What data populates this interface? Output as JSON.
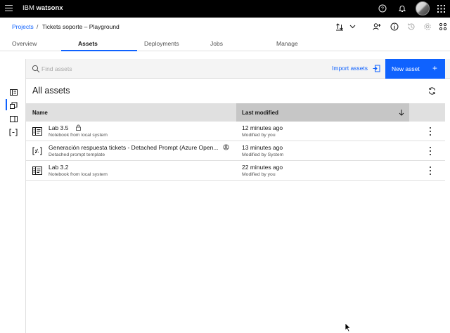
{
  "header": {
    "brand_prefix": "IBM",
    "brand_product": "watsonx",
    "icons": [
      "menu-icon",
      "help-icon",
      "notification-icon",
      "avatar",
      "app-switcher-icon"
    ]
  },
  "breadcrumb": {
    "root": "Projects",
    "separator": "/",
    "current": "Tickets soporte – Playground"
  },
  "tabs": [
    {
      "label": "Overview"
    },
    {
      "label": "Assets",
      "active": true
    },
    {
      "label": "Deployments"
    },
    {
      "label": "Jobs"
    },
    {
      "label": "Manage"
    }
  ],
  "toolbar": {
    "search_placeholder": "Find assets",
    "import_label": "Import assets",
    "new_label": "New asset",
    "new_plus": "+"
  },
  "section": {
    "title": "All assets"
  },
  "table": {
    "columns": {
      "name": "Name",
      "modified": "Last modified"
    },
    "rows": [
      {
        "title": "Lab 3.5",
        "subtitle": "Notebook from local system",
        "modified": "12 minutes ago",
        "by": "Modified by you",
        "icon": "notebook-icon",
        "badge": "lock-icon"
      },
      {
        "title": "Generación respuesta tickets - Detached Prompt (Azure Open...",
        "subtitle": "Detached prompt template",
        "modified": "13 minutes ago",
        "by": "Modified by System",
        "icon": "prompt-template-icon",
        "badge": "badge-icon"
      },
      {
        "title": "Lab 3.2",
        "subtitle": "Notebook from local system",
        "modified": "22 minutes ago",
        "by": "Modified by you",
        "icon": "notebook-icon"
      }
    ]
  },
  "colors": {
    "accent": "#0f62fe",
    "header_bg": "#000000",
    "table_header": "#e0e0e0",
    "sorted_header": "#c6c6c6"
  }
}
